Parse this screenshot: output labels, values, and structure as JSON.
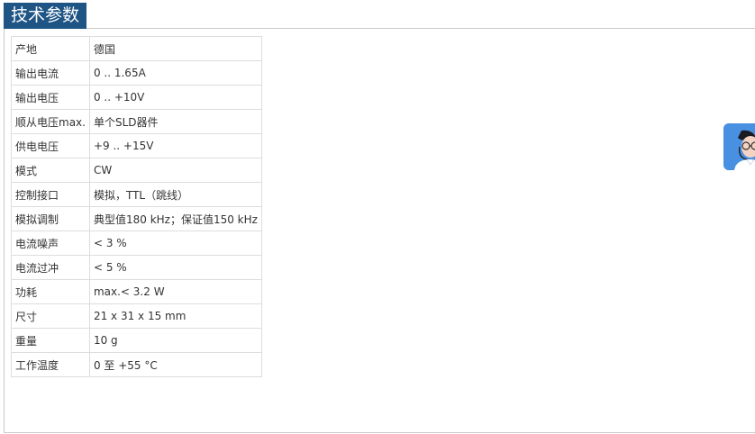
{
  "section": {
    "title": "技术参数"
  },
  "specs": [
    {
      "label": "产地",
      "value": "德国"
    },
    {
      "label": "输出电流",
      "value": "0 .. 1.65A"
    },
    {
      "label": "输出电压",
      "value": "0 .. +10V"
    },
    {
      "label": "顺从电压max.",
      "value": "单个SLD器件"
    },
    {
      "label": "供电电压",
      "value": "+9 .. +15V"
    },
    {
      "label": "模式",
      "value": "CW"
    },
    {
      "label": "控制接口",
      "value": "模拟，TTL（跳线）"
    },
    {
      "label": "模拟调制",
      "value": "典型值180 kHz；保证值150 kHz"
    },
    {
      "label": "电流噪声",
      "value": "< 3 %"
    },
    {
      "label": "电流过冲",
      "value": "< 5 %"
    },
    {
      "label": "功耗",
      "value": "max.< 3.2 W"
    },
    {
      "label": "尺寸",
      "value": "21 x 31 x 15 mm"
    },
    {
      "label": "重量",
      "value": "10 g"
    },
    {
      "label": "工作温度",
      "value": "0 至 +55 °C"
    }
  ],
  "support_widget": {
    "icon": "customer-service-avatar-icon",
    "accent_color": "#4a90e2"
  },
  "colors": {
    "title_background": "#1e5585",
    "table_border": "#dddddd"
  }
}
